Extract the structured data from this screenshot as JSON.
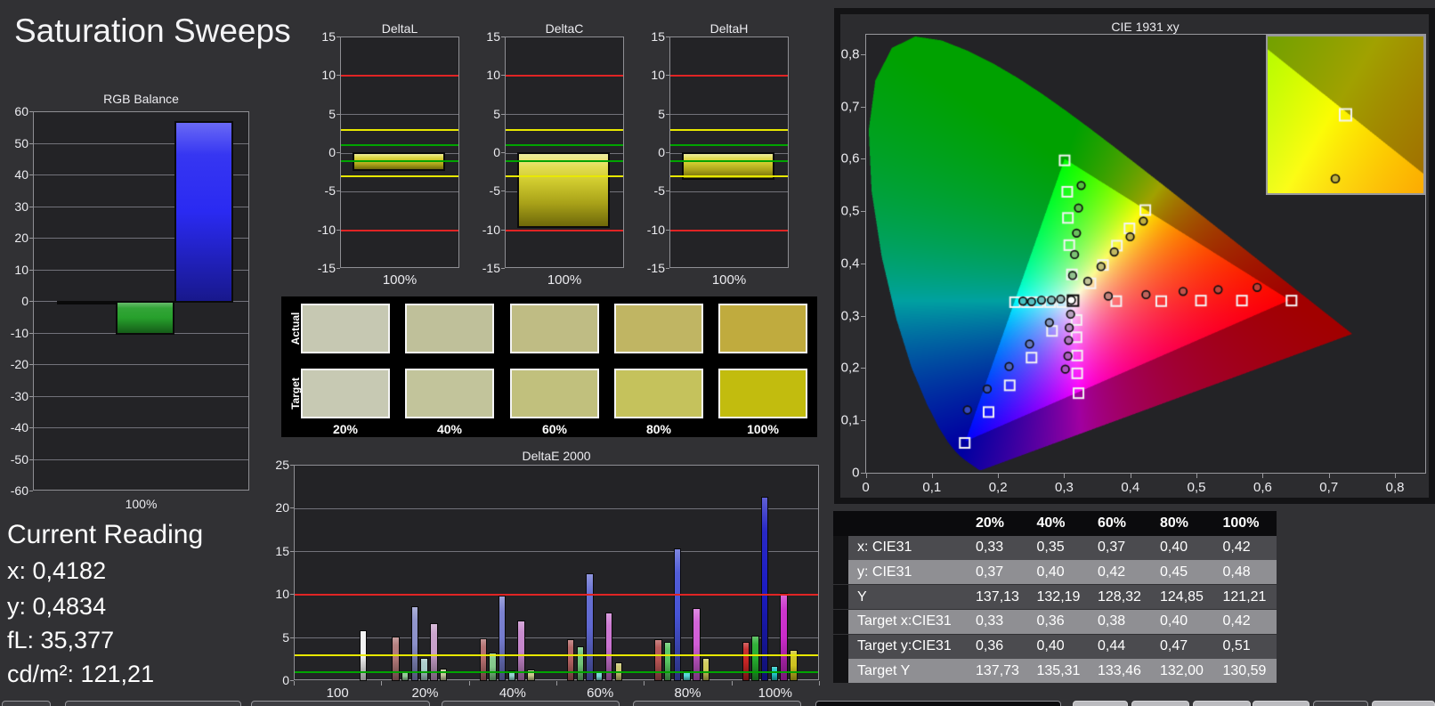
{
  "window": {
    "title": "Saturation Sweeps"
  },
  "reading": {
    "title": "Current Reading",
    "lines": [
      "x: 0,4182",
      "y: 0,4834",
      "fL: 35,377",
      "cd/m²: 121,21"
    ]
  },
  "colors": {
    "background": "#313134",
    "plot_background": "#232326",
    "limit_red": "#e02424",
    "limit_yellow": "#e8e800",
    "limit_green": "#00a400",
    "delta_bar_yellow": "#d8d42c"
  },
  "chart_data": [
    {
      "id": "rgb_balance",
      "type": "bar",
      "title": "RGB Balance",
      "categories": [
        "100%"
      ],
      "series": [
        {
          "name": "red",
          "values": [
            -0.4
          ],
          "color": "#c22222"
        },
        {
          "name": "green",
          "values": [
            -10.0
          ],
          "color": "#27a02c"
        },
        {
          "name": "blue",
          "values": [
            57.0
          ],
          "color": "#2a2af2"
        }
      ],
      "ylim": [
        -60,
        60
      ],
      "ytick_labels": [
        "60",
        "50",
        "40",
        "30",
        "20",
        "10",
        "0",
        "-10",
        "-20",
        "-30",
        "-40",
        "-50",
        "-60"
      ],
      "xlabel": "100%",
      "ylabel": "",
      "grid": true,
      "legend": "none"
    },
    {
      "id": "delta_sweeps",
      "type": "bar",
      "titles": [
        "DeltaL",
        "DeltaC",
        "DeltaH"
      ],
      "values": [
        -2.2,
        -9.6,
        -3.4
      ],
      "bar_color": "#d8d42c",
      "categories": [
        "100%"
      ],
      "ylim": [
        -15,
        15
      ],
      "ytick_labels": [
        "15",
        "10",
        "5",
        "0",
        "-5",
        "-10",
        "-15"
      ],
      "limits": {
        "red": 10,
        "yellow": 3,
        "green": 1
      },
      "xlabel": "100%",
      "grid": true
    },
    {
      "id": "swatches",
      "type": "table",
      "row_labels": [
        "Actual",
        "Target"
      ],
      "columns": [
        "20%",
        "40%",
        "60%",
        "80%",
        "100%"
      ],
      "actual_colors": [
        "#c6c8b2",
        "#bfc09a",
        "#bfbc84",
        "#c0b563",
        "#c0ab3e"
      ],
      "target_colors": [
        "#c7c9b3",
        "#c2c49b",
        "#c1c07d",
        "#c5c25c",
        "#c2bc0e"
      ]
    },
    {
      "id": "deltae2000",
      "type": "bar",
      "title": "DeltaE 2000",
      "ylim": [
        0,
        25
      ],
      "ytick_labels": [
        "25",
        "20",
        "15",
        "10",
        "5",
        "0"
      ],
      "limits": {
        "red": 10,
        "yellow": 3,
        "green": 1
      },
      "groups": [
        {
          "label": "100",
          "bars": [
            {
              "name": "white",
              "value": 5.7,
              "color": "#f2f2f2",
              "slot": 5.8
            }
          ]
        },
        {
          "label": "20%",
          "bars": [
            {
              "name": "red",
              "value": 5.0,
              "color": "#b07878"
            },
            {
              "name": "green",
              "value": 0.9,
              "color": "#92c795"
            },
            {
              "name": "blue",
              "value": 8.5,
              "color": "#8b90c9"
            },
            {
              "name": "cyan",
              "value": 2.5,
              "color": "#a8cbc9"
            },
            {
              "name": "magenta",
              "value": 6.5,
              "color": "#c79fc9"
            },
            {
              "name": "yellow",
              "value": 1.2,
              "color": "#c6c69c"
            }
          ]
        },
        {
          "label": "40%",
          "bars": [
            {
              "name": "red",
              "value": 4.8,
              "color": "#b26c6c"
            },
            {
              "name": "green",
              "value": 3.1,
              "color": "#83c98a"
            },
            {
              "name": "blue",
              "value": 9.7,
              "color": "#747bcd"
            },
            {
              "name": "cyan",
              "value": 1.0,
              "color": "#92d0cf"
            },
            {
              "name": "magenta",
              "value": 6.8,
              "color": "#c585cb"
            },
            {
              "name": "yellow",
              "value": 1.1,
              "color": "#c9c78b"
            }
          ]
        },
        {
          "label": "60%",
          "bars": [
            {
              "name": "red",
              "value": 4.7,
              "color": "#b26161"
            },
            {
              "name": "green",
              "value": 3.8,
              "color": "#70c577"
            },
            {
              "name": "blue",
              "value": 12.3,
              "color": "#5f68d1"
            },
            {
              "name": "cyan",
              "value": 0.9,
              "color": "#76d3d3"
            },
            {
              "name": "magenta",
              "value": 7.7,
              "color": "#ca73d1"
            },
            {
              "name": "yellow",
              "value": 2.0,
              "color": "#cbc771"
            }
          ]
        },
        {
          "label": "80%",
          "bars": [
            {
              "name": "red",
              "value": 4.7,
              "color": "#b45353"
            },
            {
              "name": "green",
              "value": 4.3,
              "color": "#57c560"
            },
            {
              "name": "blue",
              "value": 15.2,
              "color": "#4754d6"
            },
            {
              "name": "cyan",
              "value": 1.0,
              "color": "#55d6d6"
            },
            {
              "name": "magenta",
              "value": 8.3,
              "color": "#d05cd6"
            },
            {
              "name": "yellow",
              "value": 2.5,
              "color": "#d0ca59"
            }
          ]
        },
        {
          "label": "100%",
          "bars": [
            {
              "name": "red",
              "value": 4.3,
              "color": "#c52525"
            },
            {
              "name": "green",
              "value": 5.1,
              "color": "#26ad2f"
            },
            {
              "name": "blue",
              "value": 21.2,
              "color": "#1c1cc2"
            },
            {
              "name": "cyan",
              "value": 1.6,
              "color": "#24caca"
            },
            {
              "name": "magenta",
              "value": 10.0,
              "color": "#ca2bca"
            },
            {
              "name": "yellow",
              "value": 3.4,
              "color": "#cec21f"
            }
          ]
        }
      ]
    },
    {
      "id": "cie1931",
      "type": "scatter",
      "title": "CIE 1931 xy",
      "xlim": [
        0,
        0.845
      ],
      "ylim": [
        0,
        0.8372
      ],
      "xtick_labels": [
        "0",
        "0,1",
        "0,2",
        "0,3",
        "0,4",
        "0,5",
        "0,6",
        "0,7",
        "0,8"
      ],
      "ytick_labels": [
        "0",
        "0,1",
        "0,2",
        "0,3",
        "0,4",
        "0,5",
        "0,6",
        "0,7",
        "0,8"
      ],
      "gamut_triangle": {
        "red": [
          0.64,
          0.33
        ],
        "green": [
          0.3,
          0.6
        ],
        "blue": [
          0.15,
          0.06
        ]
      },
      "white_point": {
        "target": [
          0.3127,
          0.329
        ],
        "measured": [
          0.31,
          0.33
        ]
      },
      "sweeps": [
        {
          "name": "red",
          "targets": [
            [
              0.378,
              0.328
            ],
            [
              0.446,
              0.328
            ],
            [
              0.506,
              0.329
            ],
            [
              0.568,
              0.329
            ],
            [
              0.643,
              0.329
            ]
          ],
          "measured": [
            [
              0.366,
              0.3375
            ],
            [
              0.423,
              0.3404
            ],
            [
              0.479,
              0.3466
            ],
            [
              0.532,
              0.3499
            ],
            [
              0.591,
              0.3543
            ]
          ]
        },
        {
          "name": "green",
          "targets": [
            [
              0.311,
              0.379
            ],
            [
              0.307,
              0.435
            ],
            [
              0.305,
              0.487
            ],
            [
              0.304,
              0.537
            ],
            [
              0.3,
              0.597
            ]
          ],
          "measured": [
            [
              0.312,
              0.377
            ],
            [
              0.315,
              0.417
            ],
            [
              0.318,
              0.458
            ],
            [
              0.321,
              0.506
            ],
            [
              0.325,
              0.549
            ]
          ]
        },
        {
          "name": "blue",
          "targets": [
            [
              0.281,
              0.271
            ],
            [
              0.25,
              0.22
            ],
            [
              0.217,
              0.167
            ],
            [
              0.185,
              0.116
            ],
            [
              0.149,
              0.057
            ]
          ],
          "measured": [
            [
              0.277,
              0.287
            ],
            [
              0.247,
              0.246
            ],
            [
              0.216,
              0.203
            ],
            [
              0.183,
              0.16
            ],
            [
              0.153,
              0.12
            ]
          ]
        },
        {
          "name": "cyan",
          "targets": [
            [
              0.296,
              0.326
            ],
            [
              0.278,
              0.326
            ],
            [
              0.26,
              0.326
            ],
            [
              0.243,
              0.326
            ],
            [
              0.225,
              0.326
            ]
          ],
          "measured": [
            [
              0.294,
              0.332
            ],
            [
              0.28,
              0.33
            ],
            [
              0.265,
              0.33
            ],
            [
              0.25,
              0.327
            ],
            [
              0.237,
              0.328
            ]
          ]
        },
        {
          "name": "magenta",
          "targets": [
            [
              0.318,
              0.292
            ],
            [
              0.318,
              0.259
            ],
            [
              0.319,
              0.224
            ],
            [
              0.319,
              0.19
            ],
            [
              0.321,
              0.152
            ]
          ],
          "measured": [
            [
              0.309,
              0.303
            ],
            [
              0.307,
              0.277
            ],
            [
              0.306,
              0.253
            ],
            [
              0.305,
              0.223
            ],
            [
              0.301,
              0.198
            ]
          ]
        },
        {
          "name": "yellow",
          "targets": [
            [
              0.339,
              0.362
            ],
            [
              0.358,
              0.397
            ],
            [
              0.379,
              0.434
            ],
            [
              0.398,
              0.467
            ],
            [
              0.422,
              0.502
            ]
          ],
          "measured": [
            [
              0.335,
              0.366
            ],
            [
              0.355,
              0.394
            ],
            [
              0.375,
              0.422
            ],
            [
              0.399,
              0.451
            ],
            [
              0.419,
              0.481
            ]
          ]
        }
      ],
      "inset": {
        "xlim": [
          0.396,
          0.448
        ],
        "ylim": [
          0.476,
          0.528
        ],
        "target": [
          0.422,
          0.502
        ],
        "measured": [
          0.4186,
          0.4808
        ]
      }
    },
    {
      "id": "cie_table",
      "type": "table",
      "columns": [
        "20%",
        "40%",
        "60%",
        "80%",
        "100%"
      ],
      "rows": [
        {
          "label": "x: CIE31",
          "values": [
            "0,33",
            "0,35",
            "0,37",
            "0,40",
            "0,42"
          ]
        },
        {
          "label": "y: CIE31",
          "values": [
            "0,37",
            "0,40",
            "0,42",
            "0,45",
            "0,48"
          ]
        },
        {
          "label": "Y",
          "values": [
            "137,13",
            "132,19",
            "128,32",
            "124,85",
            "121,21"
          ]
        },
        {
          "label": "Target x:CIE31",
          "values": [
            "0,33",
            "0,36",
            "0,38",
            "0,40",
            "0,42"
          ]
        },
        {
          "label": "Target y:CIE31",
          "values": [
            "0,36",
            "0,40",
            "0,44",
            "0,47",
            "0,51"
          ]
        },
        {
          "label": "Target Y",
          "values": [
            "137,73",
            "135,31",
            "133,46",
            "132,00",
            "130,59"
          ]
        }
      ]
    }
  ]
}
